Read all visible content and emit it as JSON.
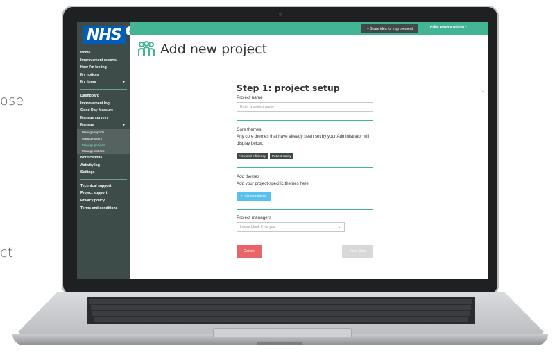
{
  "background": {
    "text_1": "ose",
    "text_2": "ct"
  },
  "sidebar": {
    "logo": "NHS",
    "collapse_icon": "‹",
    "nav_group_1": [
      {
        "label": "Home"
      },
      {
        "label": "Improvement reports"
      },
      {
        "label": "How I'm feeling"
      },
      {
        "label": "My notices"
      },
      {
        "label": "My items",
        "caret": "▾"
      }
    ],
    "nav_group_2": [
      {
        "label": "Dashboard"
      },
      {
        "label": "Improvement log"
      },
      {
        "label": "Good Day Measure"
      },
      {
        "label": "Manage surveys"
      },
      {
        "label": "Manage",
        "caret": "▾"
      }
    ],
    "manage_sub": [
      {
        "label": "Manage reports"
      },
      {
        "label": "Manage users"
      },
      {
        "label": "Manage projects",
        "active": true
      },
      {
        "label": "Manage notices"
      }
    ],
    "nav_group_3": [
      {
        "label": "Notifications"
      },
      {
        "label": "Activity log"
      },
      {
        "label": "Settings"
      }
    ],
    "nav_group_4": [
      {
        "label": "Technical support"
      },
      {
        "label": "Project support"
      },
      {
        "label": "Privacy policy"
      },
      {
        "label": "Terms and conditions"
      }
    ]
  },
  "topbar": {
    "share_label": "+ Share idea for improvement",
    "user_greeting": "Hello, Rowena Wilding ▾",
    "bell_icon": "🔔"
  },
  "page": {
    "title": "Add new project",
    "icon": "people-group-icon"
  },
  "form": {
    "step_heading": "Step 1: project setup",
    "project_name_label": "Project name",
    "project_name_placeholder": "Enter a project name",
    "core_themes_heading": "Core themes",
    "core_themes_desc": "Any core themes that have already been set by your Administrator will display below.",
    "core_tags": [
      "Flow and efficiency",
      "Patient safety"
    ],
    "add_themes_heading": "Add themes",
    "add_themes_desc": "Add your project-specific themes here.",
    "add_theme_button": "+ Add new theme",
    "project_managers_label": "Project managers",
    "project_managers_placeholder": "Leave blank if it's you",
    "cancel_button": "Cancel",
    "next_button": "Next step"
  },
  "colors": {
    "accent": "#43b594",
    "sidebar": "#3d4b49",
    "cancel": "#e86667",
    "add_theme": "#57c0ef",
    "nhs_blue": "#005eb8"
  }
}
